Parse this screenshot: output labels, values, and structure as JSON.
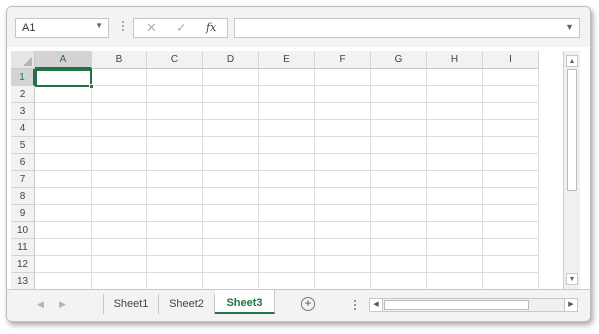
{
  "formula_bar": {
    "name_box": "A1",
    "name_box_dropdown_icon": "chevron-down-icon",
    "cancel_icon": "✕",
    "enter_icon": "✓",
    "fx_label": "fx",
    "formula_value": "",
    "expand_icon": "chevron-down-icon"
  },
  "grid": {
    "columns": [
      "A",
      "B",
      "C",
      "D",
      "E",
      "F",
      "G",
      "H",
      "I"
    ],
    "rows": [
      "1",
      "2",
      "3",
      "4",
      "5",
      "6",
      "7",
      "8",
      "9",
      "10",
      "11",
      "12",
      "13"
    ],
    "active_cell": "A1",
    "selected_column": "A",
    "selected_row": "1"
  },
  "sheet_tabs": {
    "tabs": [
      {
        "label": "Sheet1",
        "active": false
      },
      {
        "label": "Sheet2",
        "active": false
      },
      {
        "label": "Sheet3",
        "active": true
      }
    ],
    "add_sheet": "⊕",
    "nav_prev": "◀",
    "nav_next": "▶"
  },
  "colors": {
    "accent": "#217346",
    "header_bg": "#f2f2f2",
    "gridline": "#dedede"
  }
}
